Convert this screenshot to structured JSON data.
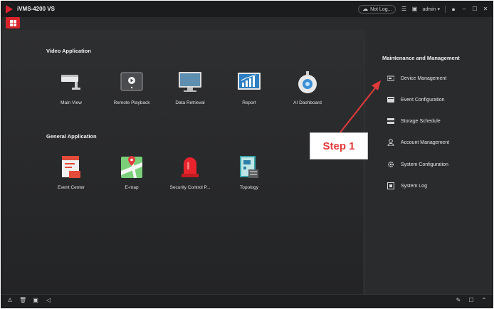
{
  "window": {
    "title": "iVMS-4200 VS",
    "account_status": "Not Log...",
    "user": "admin"
  },
  "video_application": {
    "title": "Video Application",
    "items": [
      {
        "label": "Main View",
        "icon": "camera-icon"
      },
      {
        "label": "Remote Playback",
        "icon": "playback-icon"
      },
      {
        "label": "Data Retrieval",
        "icon": "monitor-icon"
      },
      {
        "label": "Report",
        "icon": "chart-icon"
      },
      {
        "label": "AI Dashboard",
        "icon": "ai-robot-icon"
      }
    ]
  },
  "general_application": {
    "title": "General Application",
    "items": [
      {
        "label": "Event Center",
        "icon": "event-center-icon"
      },
      {
        "label": "E-map",
        "icon": "map-icon"
      },
      {
        "label": "Security Control P...",
        "icon": "alarm-light-icon"
      },
      {
        "label": "Topology",
        "icon": "topology-icon"
      }
    ]
  },
  "maintenance": {
    "title": "Maintenance and Management",
    "items": [
      {
        "label": "Device Management",
        "icon": "device-icon"
      },
      {
        "label": "Event Configuration",
        "icon": "event-config-icon"
      },
      {
        "label": "Storage Schedule",
        "icon": "storage-icon"
      },
      {
        "label": "Account Management",
        "icon": "account-icon"
      },
      {
        "label": "System Configuration",
        "icon": "gear-icon"
      },
      {
        "label": "System Log",
        "icon": "log-icon"
      }
    ]
  },
  "annotation": {
    "step_label": "Step 1",
    "color": "#e23a3a"
  },
  "colors": {
    "accent": "#d9242c",
    "background": "#2a2b2d",
    "text": "#e6e6e6"
  }
}
